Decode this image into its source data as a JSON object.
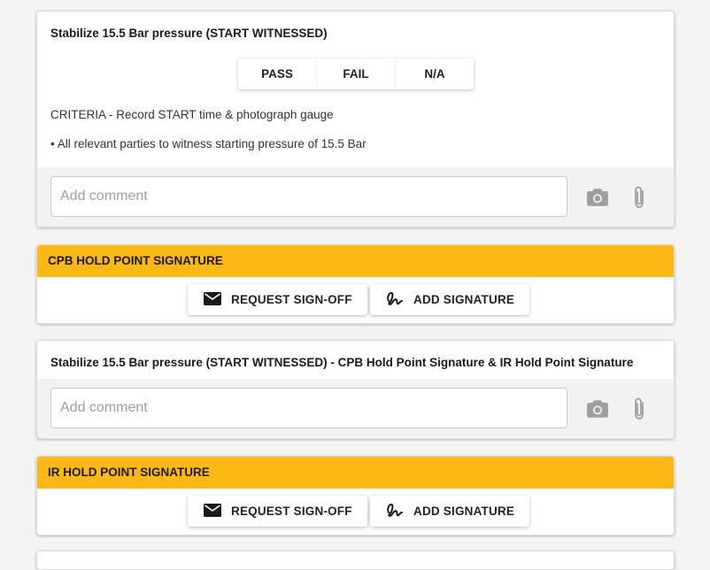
{
  "step1": {
    "title": "Stabilize 15.5 Bar pressure (START WITNESSED)",
    "options": [
      "PASS",
      "FAIL",
      "N/A"
    ],
    "criteria": "CRITERIA - Record START time & photograph gauge",
    "bullet": "• All relevant parties to witness starting pressure of 15.5 Bar",
    "comment_placeholder": "Add comment"
  },
  "cpb_signature": {
    "header": "CPB HOLD POINT SIGNATURE",
    "request_label": "REQUEST SIGN-OFF",
    "add_label": "ADD SIGNATURE"
  },
  "step2": {
    "title": "Stabilize 15.5 Bar pressure (START WITNESSED) - CPB Hold Point Signature & IR Hold Point Signature",
    "comment_placeholder": "Add comment"
  },
  "ir_signature": {
    "header": "IR HOLD POINT SIGNATURE",
    "request_label": "REQUEST SIGN-OFF",
    "add_label": "ADD SIGNATURE"
  },
  "icons": {
    "camera": "camera-icon",
    "attach": "paperclip-icon",
    "mail": "mail-icon",
    "signature": "signature-icon"
  },
  "colors": {
    "accent": "#fdb913",
    "icon_grey": "#9e9e9e"
  }
}
